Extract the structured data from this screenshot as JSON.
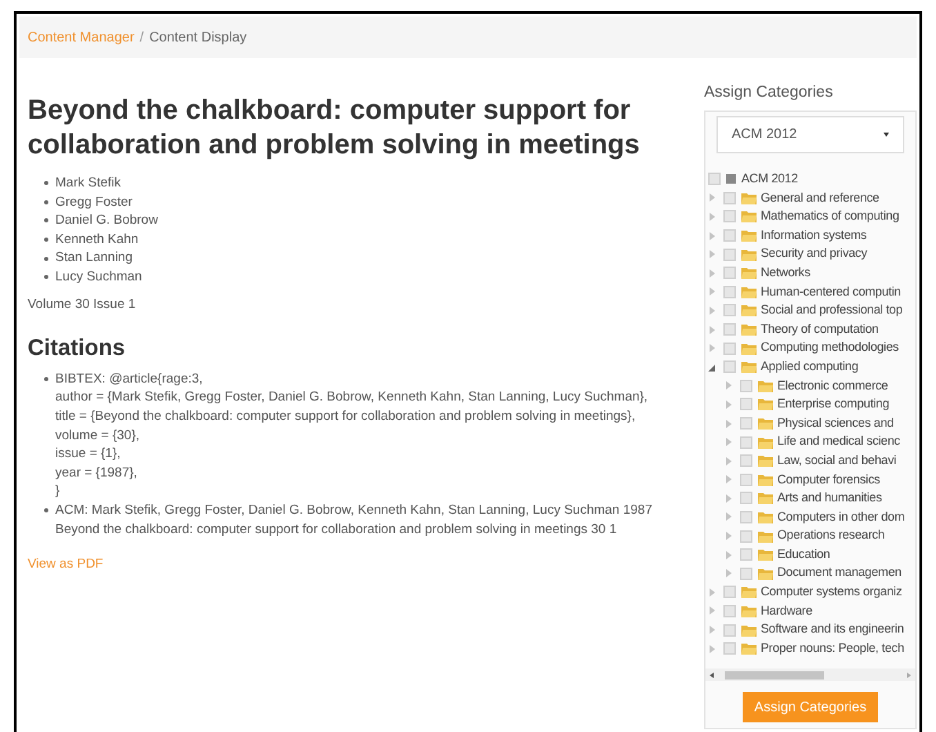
{
  "breadcrumb": [
    {
      "label": "Content Manager",
      "kind": "link"
    },
    {
      "label": "Content Display",
      "kind": "current"
    }
  ],
  "breadcrumb_separator": "/",
  "title": "Beyond the chalkboard: computer support for collaboration and problem solving in meetings",
  "authors": [
    "Mark Stefik",
    "Gregg Foster",
    "Daniel G. Bobrow",
    "Kenneth Kahn",
    "Stan Lanning",
    "Lucy Suchman"
  ],
  "volume": "Volume 30 Issue 1",
  "citations": {
    "heading": "Citations",
    "items": [
      {
        "kind": "lines",
        "lines": [
          "BIBTEX: @article{rage:3,",
          "author = {Mark Stefik, Gregg Foster, Daniel G. Bobrow, Kenneth Kahn, Stan Lanning, Lucy Suchman},",
          "title = {Beyond the chalkboard: computer support for collaboration and problem solving in meetings},",
          "volume = {30},",
          "issue = {1},",
          "year = {1987},",
          "}"
        ]
      },
      {
        "kind": "paragraph",
        "text": "ACM: Mark Stefik, Gregg Foster, Daniel G. Bobrow, Kenneth Kahn, Stan Lanning, Lucy Suchman 1987 Beyond the chalkboard: computer support for collaboration and problem solving in meetings 30 1"
      }
    ]
  },
  "pdf_link": "View as PDF",
  "sidebar": {
    "heading": "Assign Categories",
    "select": {
      "value": "ACM 2012"
    },
    "tree": [
      {
        "label": "ACM 2012",
        "kind": "root",
        "checked": false,
        "children": [
          {
            "label": "General and reference",
            "kind": "folder",
            "checked": false,
            "expanded": false
          },
          {
            "label": "Mathematics of computing",
            "kind": "folder",
            "checked": false,
            "expanded": false
          },
          {
            "label": "Information systems",
            "kind": "folder",
            "checked": false,
            "expanded": false
          },
          {
            "label": "Security and privacy",
            "kind": "folder",
            "checked": false,
            "expanded": false
          },
          {
            "label": "Networks",
            "kind": "folder",
            "checked": false,
            "expanded": false
          },
          {
            "label": "Human-centered computin",
            "kind": "folder",
            "checked": false,
            "expanded": false
          },
          {
            "label": "Social and professional top",
            "kind": "folder",
            "checked": false,
            "expanded": false
          },
          {
            "label": "Theory of computation",
            "kind": "folder",
            "checked": false,
            "expanded": false
          },
          {
            "label": "Computing methodologies",
            "kind": "folder",
            "checked": false,
            "expanded": false
          },
          {
            "label": "Applied computing",
            "kind": "folder",
            "checked": false,
            "expanded": true,
            "children": [
              {
                "label": "Electronic commerce",
                "kind": "folder",
                "checked": false,
                "expanded": false
              },
              {
                "label": "Enterprise computing",
                "kind": "folder",
                "checked": false,
                "expanded": false
              },
              {
                "label": "Physical sciences and",
                "kind": "folder",
                "checked": false,
                "expanded": false
              },
              {
                "label": "Life and medical scienc",
                "kind": "folder",
                "checked": false,
                "expanded": false
              },
              {
                "label": "Law, social and behavi",
                "kind": "folder",
                "checked": false,
                "expanded": false
              },
              {
                "label": "Computer forensics",
                "kind": "folder",
                "checked": false,
                "expanded": false
              },
              {
                "label": "Arts and humanities",
                "kind": "folder",
                "checked": false,
                "expanded": false
              },
              {
                "label": "Computers in other dom",
                "kind": "folder",
                "checked": false,
                "expanded": false
              },
              {
                "label": "Operations research",
                "kind": "folder",
                "checked": false,
                "expanded": false
              },
              {
                "label": "Education",
                "kind": "folder",
                "checked": false,
                "expanded": false
              },
              {
                "label": "Document managemen",
                "kind": "folder",
                "checked": false,
                "expanded": false
              }
            ]
          },
          {
            "label": "Computer systems organiz",
            "kind": "folder",
            "checked": false,
            "expanded": false
          },
          {
            "label": "Hardware",
            "kind": "folder",
            "checked": false,
            "expanded": false
          },
          {
            "label": "Software and its engineerin",
            "kind": "folder",
            "checked": false,
            "expanded": false
          },
          {
            "label": "Proper nouns: People, tech",
            "kind": "folder",
            "checked": false,
            "expanded": false
          }
        ]
      }
    ],
    "button": "Assign Categories"
  }
}
